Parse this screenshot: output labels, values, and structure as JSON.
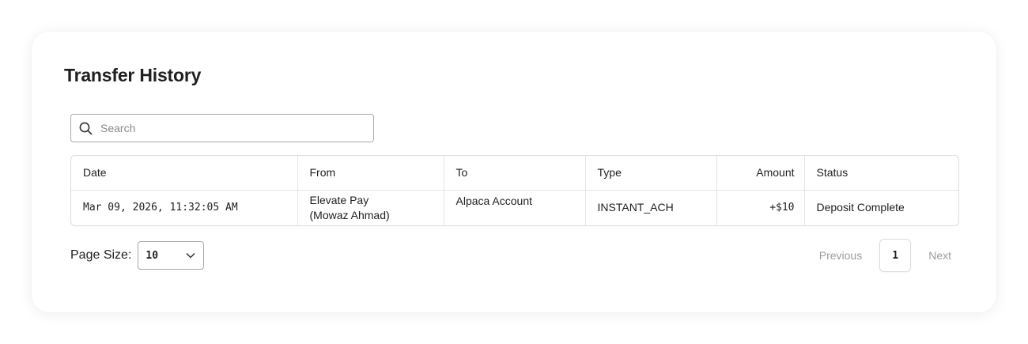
{
  "page": {
    "title": "Transfer History"
  },
  "search": {
    "placeholder": "Search",
    "value": ""
  },
  "table": {
    "headers": {
      "date": "Date",
      "from": "From",
      "to": "To",
      "type": "Type",
      "amount": "Amount",
      "status": "Status"
    },
    "rows": [
      {
        "date": "Mar 09, 2026, 11:32:05 AM",
        "from_line1": "Elevate Pay",
        "from_line2": "(Mowaz Ahmad)",
        "to": "Alpaca Account",
        "type": "INSTANT_ACH",
        "amount": "+$10",
        "status": "Deposit Complete"
      }
    ]
  },
  "pagination": {
    "page_size_label": "Page Size:",
    "page_size_value": "10",
    "previous_label": "Previous",
    "current_page": "1",
    "next_label": "Next"
  }
}
